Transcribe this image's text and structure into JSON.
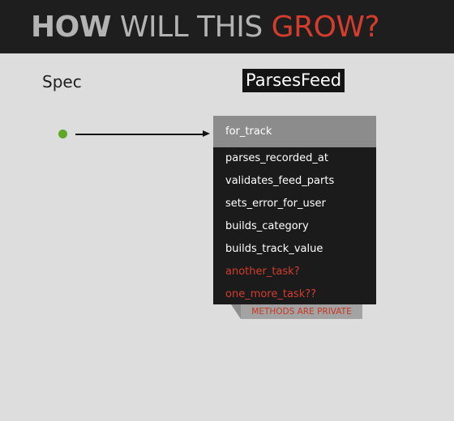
{
  "header": {
    "title_part1": "HOW",
    "title_part2": "WILL THIS",
    "title_part3": "GROW?"
  },
  "diagram": {
    "spec_label": "Spec",
    "class_label": "ParsesFeed",
    "methods": [
      {
        "name": "for_track",
        "state": "highlighted"
      },
      {
        "name": "parses_recorded_at",
        "state": "normal"
      },
      {
        "name": "validates_feed_parts",
        "state": "normal"
      },
      {
        "name": "sets_error_for_user",
        "state": "normal"
      },
      {
        "name": "builds_category",
        "state": "normal"
      },
      {
        "name": "builds_track_value",
        "state": "normal"
      },
      {
        "name": "another_task?",
        "state": "future"
      },
      {
        "name": "one_more_task??",
        "state": "future"
      }
    ],
    "note": "METHODS ARE PRIVATE"
  },
  "colors": {
    "header_bg": "#1e1e1e",
    "page_bg": "#dddddd",
    "accent_red": "#d43d2d",
    "dot_green": "#5fa826",
    "highlight_row": "#8c8c8c"
  }
}
